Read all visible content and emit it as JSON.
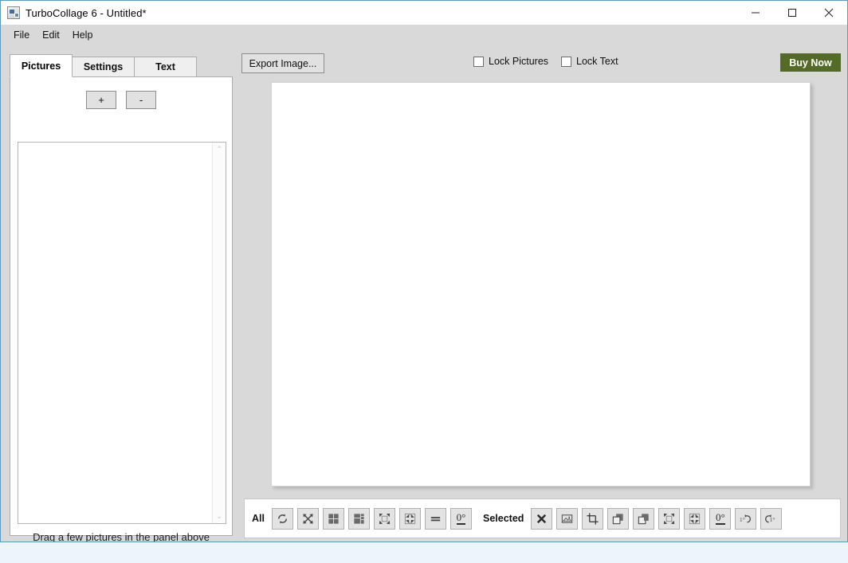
{
  "window": {
    "title": "TurboCollage 6 - Untitled*",
    "app_icon": "app-icon",
    "controls": {
      "minimize": "minimize-icon",
      "maximize": "maximize-icon",
      "close": "close-icon"
    }
  },
  "menu": {
    "items": [
      {
        "label": "File"
      },
      {
        "label": "Edit"
      },
      {
        "label": "Help"
      }
    ]
  },
  "sidebar": {
    "tabs": [
      {
        "label": "Pictures",
        "active": true
      },
      {
        "label": "Settings",
        "active": false
      },
      {
        "label": "Text",
        "active": false
      }
    ],
    "add_button": "+",
    "remove_button": "-",
    "hint": "Drag a few pictures in the panel above",
    "scroll_up": "⌃",
    "scroll_down": "⌄"
  },
  "toolbar": {
    "export_label": "Export Image...",
    "lock_pictures_label": "Lock Pictures",
    "lock_pictures_checked": false,
    "lock_text_label": "Lock Text",
    "lock_text_checked": false,
    "buy_label": "Buy Now",
    "buy_color": "#536b26"
  },
  "bottom_toolbar": {
    "all_label": "All",
    "selected_label": "Selected",
    "all_tools": [
      {
        "name": "regenerate-icon",
        "type": "refresh"
      },
      {
        "name": "shuffle-icon",
        "type": "shuffle"
      },
      {
        "name": "grid-layout-icon",
        "type": "grid"
      },
      {
        "name": "mixed-layout-icon",
        "type": "grid-mixed"
      },
      {
        "name": "expand-all-icon",
        "type": "expand"
      },
      {
        "name": "shrink-all-icon",
        "type": "shrink"
      },
      {
        "name": "equalize-icon",
        "type": "equals"
      },
      {
        "name": "reset-rotation-icon",
        "type": "deg",
        "text": "0°"
      }
    ],
    "selected_tools": [
      {
        "name": "delete-selected-icon",
        "type": "close"
      },
      {
        "name": "replace-picture-icon",
        "type": "picture"
      },
      {
        "name": "crop-icon",
        "type": "crop"
      },
      {
        "name": "bring-forward-icon",
        "type": "bring-front"
      },
      {
        "name": "send-backward-icon",
        "type": "send-back"
      },
      {
        "name": "expand-selected-icon",
        "type": "expand"
      },
      {
        "name": "shrink-selected-icon",
        "type": "shrink"
      },
      {
        "name": "reset-rotation-selected-icon",
        "type": "deg",
        "text": "0°"
      },
      {
        "name": "rotate-ccw-icon",
        "type": "rot-ccw",
        "text": "1°"
      },
      {
        "name": "rotate-cw-icon",
        "type": "rot-cw",
        "text": "1°"
      }
    ]
  },
  "canvas": {
    "name": "collage-canvas",
    "background": "#ffffff"
  }
}
